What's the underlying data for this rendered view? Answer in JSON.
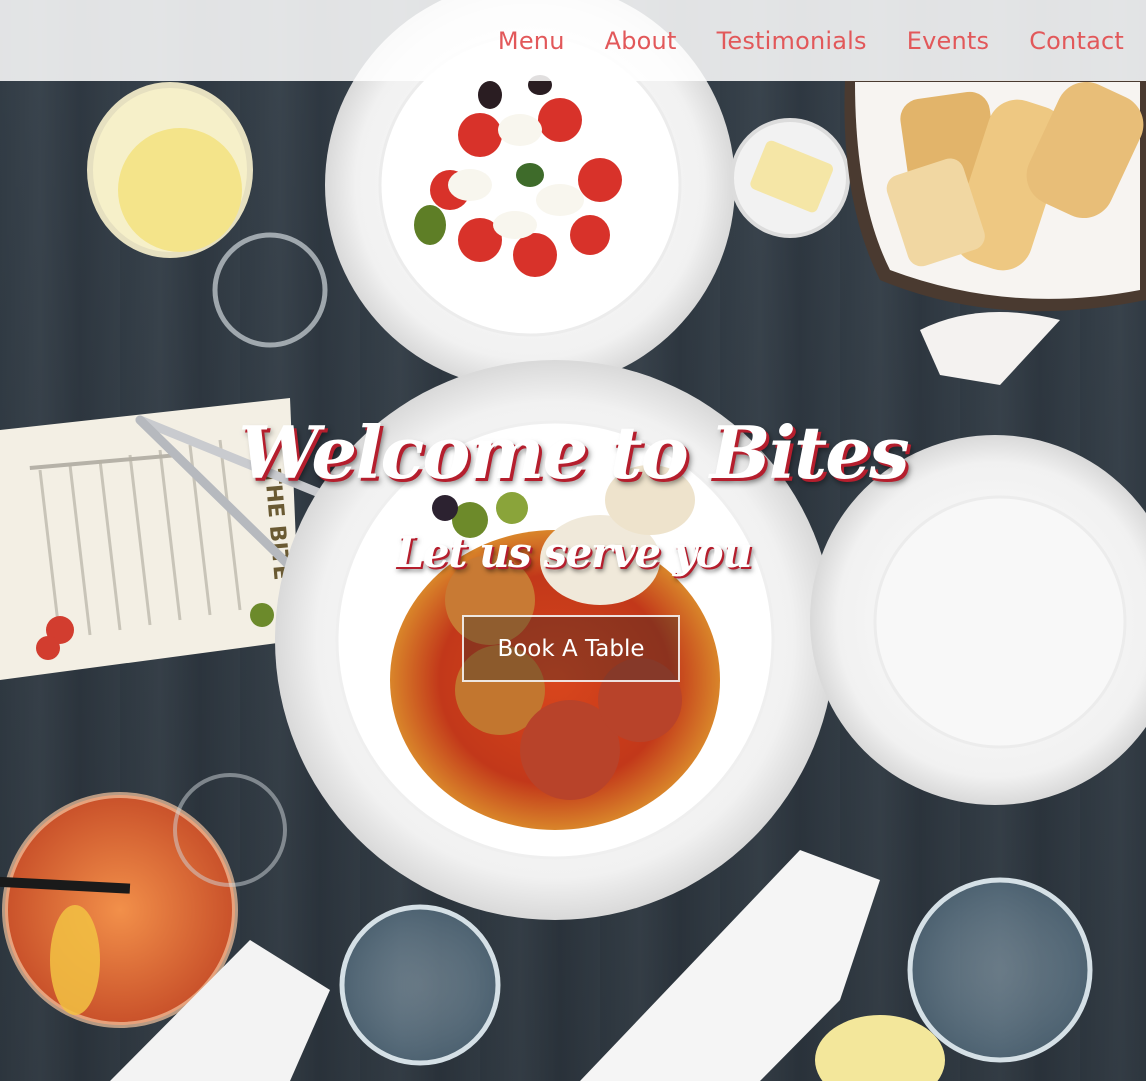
{
  "nav": {
    "items": [
      {
        "label": "Menu"
      },
      {
        "label": "About"
      },
      {
        "label": "Testimonials"
      },
      {
        "label": "Events"
      },
      {
        "label": "Contact"
      }
    ]
  },
  "hero": {
    "title": "Welcome to Bites",
    "subtitle": "Let us serve you",
    "cta_label": "Book A Table"
  },
  "background_image": {
    "menu_card_heading": "THE BITE"
  },
  "colors": {
    "nav_link": "#e2585a",
    "title_shadow": "#b51e2d",
    "table": "#3b4752"
  }
}
